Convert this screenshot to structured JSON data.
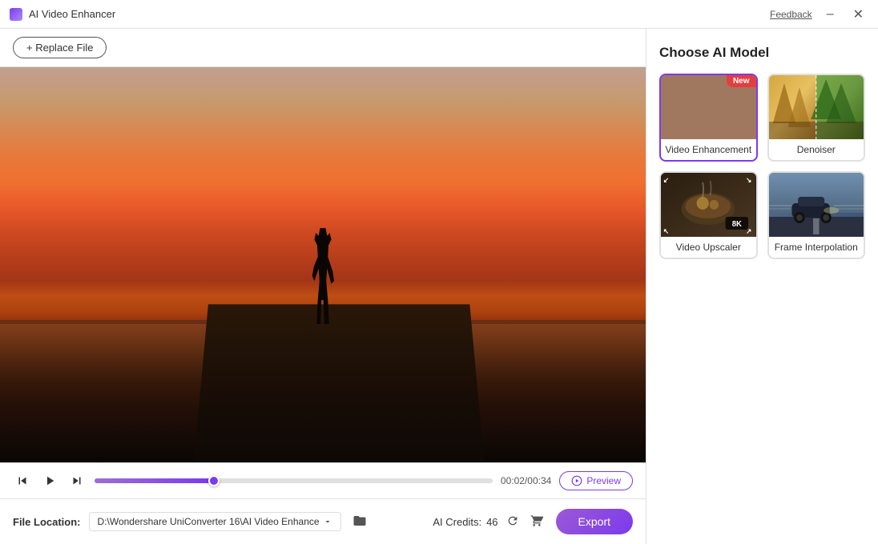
{
  "titleBar": {
    "appName": "AI Video Enhancer",
    "feedback": "Feedback",
    "minimizeLabel": "–",
    "closeLabel": "✕"
  },
  "toolbar": {
    "replaceFile": "+ Replace File"
  },
  "videoControls": {
    "timeDisplay": "00:02/00:34",
    "previewLabel": "Preview",
    "progressPercent": 30
  },
  "rightPanel": {
    "title": "Choose AI Model",
    "models": [
      {
        "id": "video-enhancement",
        "label": "Video Enhancement",
        "isNew": true,
        "selected": true
      },
      {
        "id": "denoiser",
        "label": "Denoiser",
        "isNew": false,
        "selected": false
      },
      {
        "id": "video-upscaler",
        "label": "Video Upscaler",
        "isNew": false,
        "selected": false
      },
      {
        "id": "frame-interpolation",
        "label": "Frame Interpolation",
        "isNew": false,
        "selected": false
      }
    ]
  },
  "bottomBar": {
    "fileLocationLabel": "File Location:",
    "filePath": "D:\\Wondershare UniConverter 16\\AI Video Enhance",
    "aiCreditsLabel": "AI Credits:",
    "aiCreditsValue": "46",
    "exportLabel": "Export"
  },
  "icons": {
    "new": "New",
    "8k": "8K"
  }
}
